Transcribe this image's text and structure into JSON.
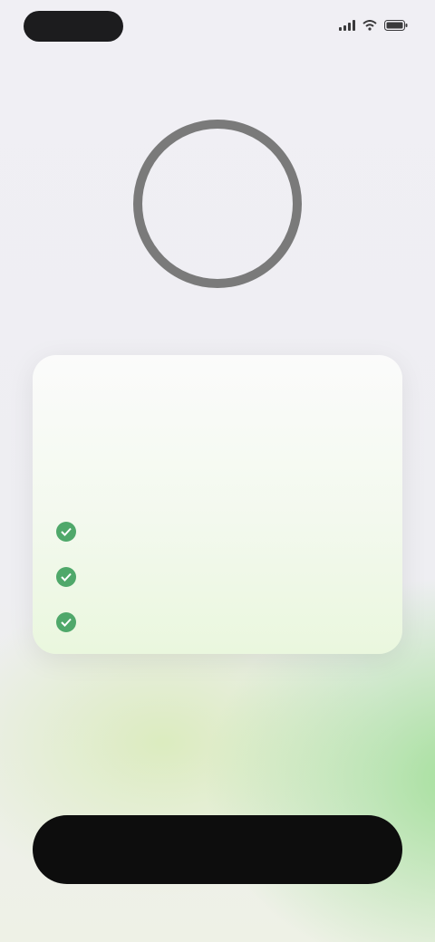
{
  "status_bar": {
    "pill_label": "",
    "icons": [
      "signal-icon",
      "wifi-icon",
      "battery-icon"
    ]
  },
  "timer": {
    "value": "",
    "ring_color": "#7a7a7a"
  },
  "card": {
    "title": "",
    "features": [
      {
        "icon": "check-icon",
        "text": ""
      },
      {
        "icon": "check-icon",
        "text": ""
      },
      {
        "icon": "check-icon",
        "text": ""
      }
    ]
  },
  "note": {
    "text": ""
  },
  "secondary_link": {
    "label": ""
  },
  "primary_button": {
    "label": ""
  },
  "colors": {
    "accent_green": "#4fa86a",
    "button_bg": "#0d0d0d",
    "background": "#efeff4"
  }
}
